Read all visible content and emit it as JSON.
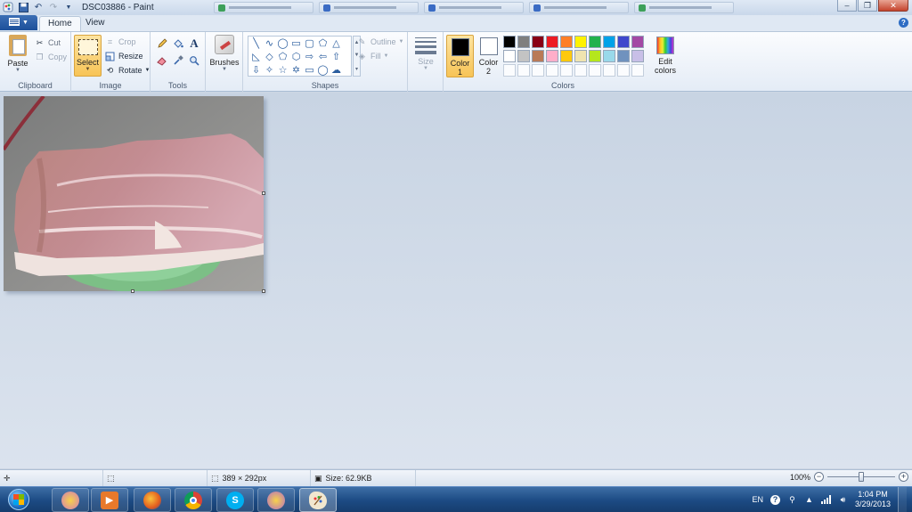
{
  "window": {
    "title": "DSC03886 - Paint",
    "controls": {
      "minimize": "–",
      "maximize": "❐",
      "close": "✕"
    }
  },
  "tabs": {
    "home": "Home",
    "view": "View"
  },
  "help": "?",
  "ribbon": {
    "clipboard": {
      "label": "Clipboard",
      "paste": "Paste",
      "cut": "Cut",
      "copy": "Copy"
    },
    "image": {
      "label": "Image",
      "select": "Select",
      "crop": "Crop",
      "resize": "Resize",
      "rotate": "Rotate"
    },
    "tools": {
      "label": "Tools",
      "text_tool": "A"
    },
    "brushes": {
      "label": "Brushes"
    },
    "shapes": {
      "label": "Shapes",
      "outline": "Outline",
      "fill": "Fill"
    },
    "size": {
      "label": "Size"
    },
    "colors": {
      "label": "Colors",
      "color1": {
        "line1": "Color",
        "line2": "1",
        "value": "#000000"
      },
      "color2": {
        "line1": "Color",
        "line2": "2",
        "value": "#ffffff"
      },
      "edit_line1": "Edit",
      "edit_line2": "colors",
      "palette_row1": [
        "#000000",
        "#7f7f7f",
        "#880015",
        "#ed1c24",
        "#ff7f27",
        "#fff200",
        "#22b14c",
        "#00a2e8",
        "#3f48cc",
        "#a349a4"
      ],
      "palette_row2": [
        "#ffffff",
        "#c3c3c3",
        "#b97a57",
        "#ffaec9",
        "#ffc90e",
        "#efe4b0",
        "#b5e61d",
        "#99d9ea",
        "#7092be",
        "#c8bfe7"
      ]
    }
  },
  "status": {
    "dimensions": "389 × 292px",
    "size": "Size: 62.9KB",
    "zoom": "100%",
    "zoom_minus": "−",
    "zoom_plus": "+",
    "zoom_level": 0.5
  },
  "taskbar": {
    "language": "EN",
    "time": "1:04 PM",
    "date": "3/29/2013"
  }
}
